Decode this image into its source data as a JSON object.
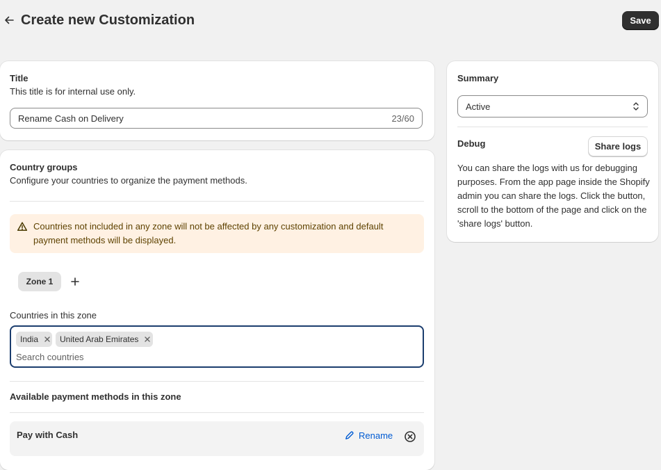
{
  "header": {
    "title": "Create new Customization",
    "save_label": "Save"
  },
  "title_card": {
    "heading": "Title",
    "helper": "This title is for internal use only.",
    "input_value": "Rename Cash on Delivery",
    "char_count": "23/60"
  },
  "country_card": {
    "heading": "Country groups",
    "description": "Configure your countries to organize the payment methods.",
    "banner_text": "Countries not included in any zone will not be affected by any customization and default payment methods will be displayed.",
    "zones": [
      {
        "label": "Zone 1"
      }
    ],
    "countries_label": "Countries in this zone",
    "selected_countries": [
      "India",
      "United Arab Emirates"
    ],
    "search_placeholder": "Search countries",
    "payment_methods_heading": "Available payment methods in this zone",
    "payment_methods": [
      {
        "name": "Pay with Cash",
        "action_label": "Rename"
      }
    ]
  },
  "summary_card": {
    "heading": "Summary",
    "status_value": "Active",
    "debug_heading": "Debug",
    "share_label": "Share logs",
    "debug_text": "You can share the logs with us for debugging purposes. From the app page inside the Shopify admin you can share the logs. Click the button, scroll to the bottom of the page and click on the 'share logs' button."
  },
  "colors": {
    "background": "#f1f1f1",
    "primary_button": "#303030",
    "banner_bg": "#fff1e3",
    "link": "#005bd3",
    "focus_border": "#1b3d6e"
  },
  "icons": {
    "back": "arrow-left-icon",
    "warning": "alert-triangle-icon",
    "add": "plus-icon",
    "tag_remove": "x-icon",
    "rename": "pencil-icon",
    "remove": "x-circle-icon",
    "select": "chevron-up-down-icon"
  }
}
